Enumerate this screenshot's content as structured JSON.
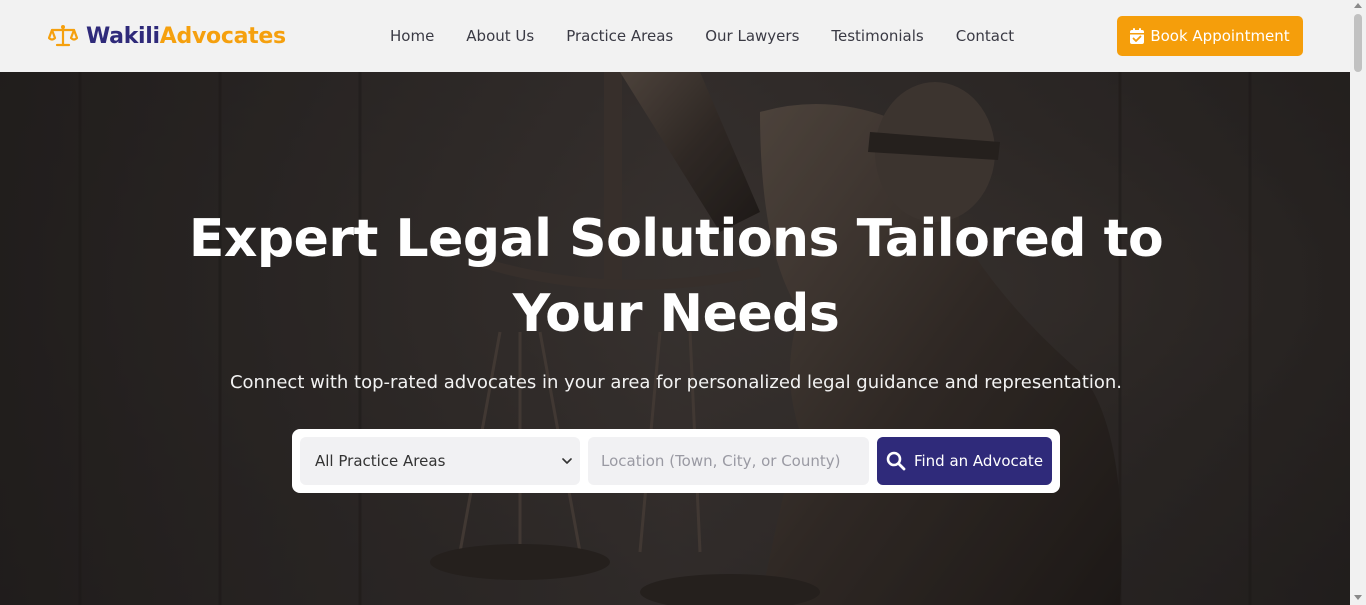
{
  "brand": {
    "name_part1": "Wakili",
    "name_part2": "Advocates",
    "icon": "scale-balance-icon",
    "primary_color": "#2f2a7a",
    "accent_color": "#f5a00e"
  },
  "nav": {
    "items": [
      {
        "label": "Home"
      },
      {
        "label": "About Us"
      },
      {
        "label": "Practice Areas"
      },
      {
        "label": "Our Lawyers"
      },
      {
        "label": "Testimonials"
      },
      {
        "label": "Contact"
      }
    ]
  },
  "header_cta": {
    "label": "Book Appointment",
    "icon": "calendar-check-icon",
    "color": "#f59e0b"
  },
  "hero": {
    "title": "Expert Legal Solutions Tailored to Your Needs",
    "subtitle": "Connect with top-rated advocates in your area for personalized legal guidance and representation."
  },
  "search": {
    "practice_select": {
      "selected": "All Practice Areas"
    },
    "location": {
      "value": "",
      "placeholder": "Location (Town, City, or County)"
    },
    "submit": {
      "label": "Find an Advocate",
      "icon": "search-icon"
    }
  }
}
